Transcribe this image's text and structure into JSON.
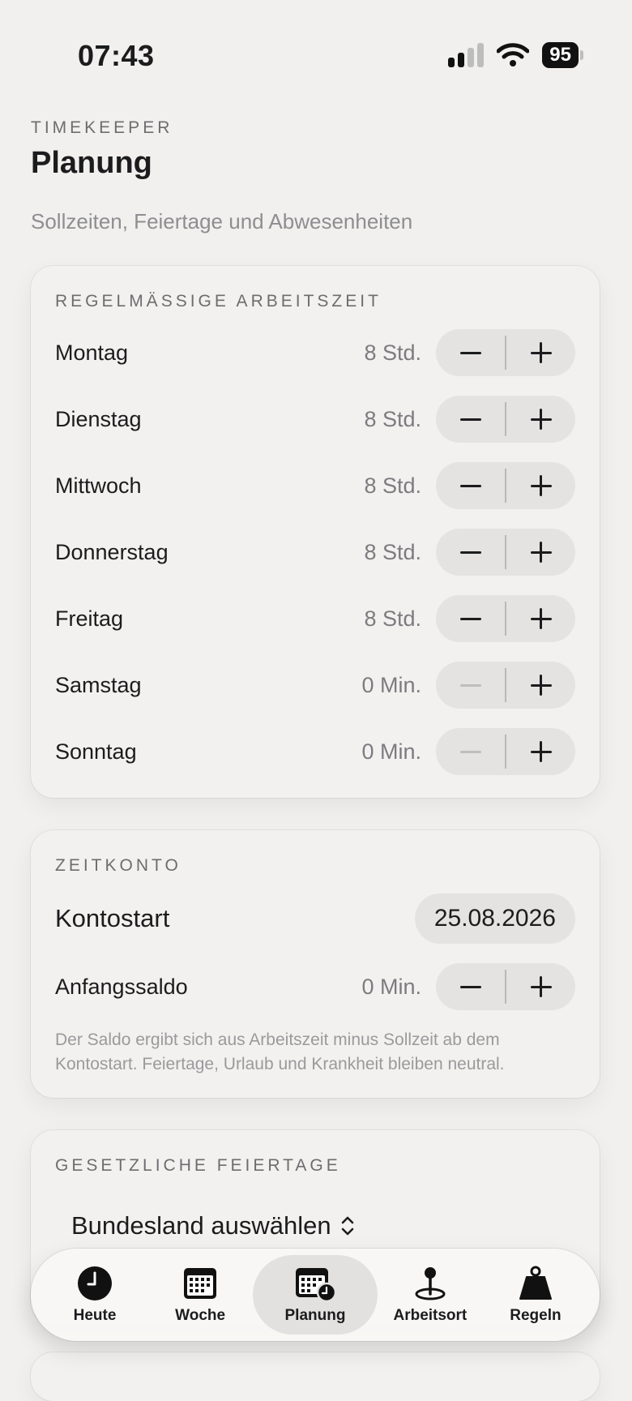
{
  "status": {
    "time": "07:43",
    "battery": "95"
  },
  "header": {
    "app_label": "TIMEKEEPER",
    "title": "Planung",
    "subtitle": "Sollzeiten, Feiertage und Abwesenheiten"
  },
  "schedule": {
    "title": "REGELMÄSSIGE ARBEITSZEIT",
    "days": [
      {
        "label": "Montag",
        "value": "8 Std."
      },
      {
        "label": "Dienstag",
        "value": "8 Std."
      },
      {
        "label": "Mittwoch",
        "value": "8 Std."
      },
      {
        "label": "Donnerstag",
        "value": "8 Std."
      },
      {
        "label": "Freitag",
        "value": "8 Std."
      },
      {
        "label": "Samstag",
        "value": "0 Min."
      },
      {
        "label": "Sonntag",
        "value": "0 Min."
      }
    ]
  },
  "account": {
    "title": "ZEITKONTO",
    "start_label": "Kontostart",
    "start_date": "25.08.2026",
    "balance_label": "Anfangssaldo",
    "balance_value": "0 Min.",
    "note": "Der Saldo ergibt sich aus Arbeitszeit minus Sollzeit ab dem Kontostart. Feiertage, Urlaub und Krankheit bleiben neutral."
  },
  "holidays": {
    "title": "GESETZLICHE FEIERTAGE",
    "picker_label": "Bundesland auswählen"
  },
  "tabs": [
    {
      "label": "Heute",
      "icon": "clock-icon"
    },
    {
      "label": "Woche",
      "icon": "calendar-icon"
    },
    {
      "label": "Planung",
      "icon": "calendar-clock-icon"
    },
    {
      "label": "Arbeitsort",
      "icon": "location-pin-icon"
    },
    {
      "label": "Regeln",
      "icon": "weight-icon"
    }
  ],
  "colors": {
    "background": "#f1f0ee",
    "card": "#f2f1ef",
    "control": "#e4e3e1",
    "text": "#1c1c1e",
    "secondary": "#7c7c80"
  }
}
